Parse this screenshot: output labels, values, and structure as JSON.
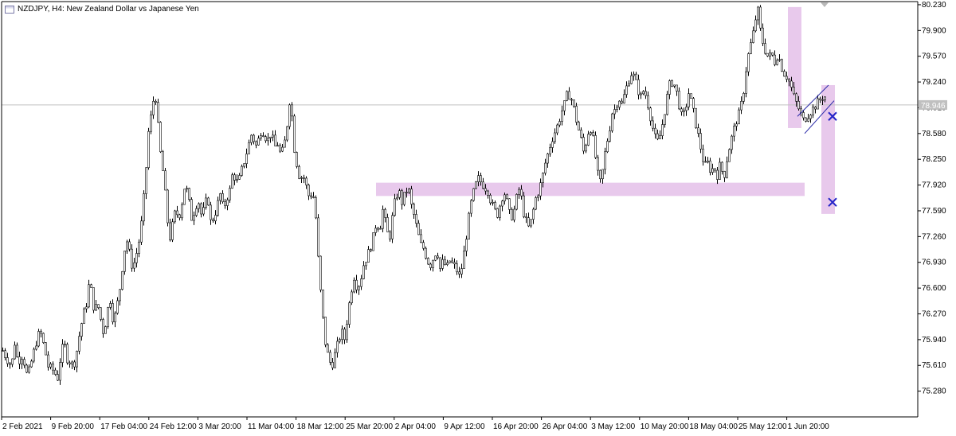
{
  "window": {
    "symbol_title": "NZDJPY, H4:  New Zealand Dollar vs Japanese Yen"
  },
  "current_price_label": "78.946",
  "colors": {
    "candle": "#000000",
    "zone": "#e8c9ec",
    "trend_lines": "#2a2aa8",
    "marker_x": "#2424c8",
    "price_line": "#c0c0c0",
    "axis": "#000000"
  },
  "chart_data": {
    "type": "bar",
    "title": "NZDJPY, H4:  New Zealand Dollar vs Japanese Yen",
    "ylim": [
      74.95,
      80.27
    ],
    "yticks": [
      "80.230",
      "79.900",
      "79.570",
      "79.240",
      "78.910",
      "78.580",
      "78.250",
      "77.920",
      "77.590",
      "77.260",
      "76.930",
      "76.600",
      "76.270",
      "75.940",
      "75.610",
      "75.280"
    ],
    "xticks": [
      "2 Feb 2021",
      "9 Feb 20:00",
      "17 Feb 04:00",
      "24 Feb 12:00",
      "3 Mar 20:00",
      "11 Mar 04:00",
      "18 Mar 12:00",
      "25 Mar 20:00",
      "2 Apr 04:00",
      "9 Apr 12:00",
      "16 Apr 20:00",
      "26 Apr 04:00",
      "3 May 12:00",
      "10 May 20:00",
      "18 May 04:00",
      "25 May 12:00",
      "1 Jun 20:00"
    ],
    "current_price": 78.946,
    "price_path": [
      [
        0,
        75.55
      ],
      [
        3,
        75.8
      ],
      [
        8,
        75.7
      ],
      [
        14,
        75.6
      ],
      [
        18,
        75.9
      ],
      [
        22,
        75.65
      ],
      [
        28,
        75.75
      ],
      [
        34,
        75.45
      ],
      [
        40,
        75.7
      ],
      [
        46,
        75.95
      ],
      [
        50,
        76.05
      ],
      [
        56,
        75.8
      ],
      [
        60,
        75.6
      ],
      [
        66,
        75.55
      ],
      [
        72,
        75.45
      ],
      [
        76,
        75.75
      ],
      [
        80,
        75.9
      ],
      [
        84,
        75.7
      ],
      [
        88,
        75.65
      ],
      [
        92,
        75.6
      ],
      [
        96,
        75.8
      ],
      [
        100,
        76.05
      ],
      [
        104,
        76.25
      ],
      [
        108,
        76.4
      ],
      [
        112,
        76.7
      ],
      [
        115,
        76.5
      ],
      [
        118,
        76.3
      ],
      [
        122,
        76.4
      ],
      [
        126,
        76.2
      ],
      [
        130,
        76.0
      ],
      [
        134,
        76.3
      ],
      [
        138,
        76.45
      ],
      [
        142,
        76.15
      ],
      [
        146,
        76.35
      ],
      [
        150,
        76.6
      ],
      [
        154,
        76.95
      ],
      [
        158,
        77.25
      ],
      [
        162,
        77.05
      ],
      [
        166,
        76.85
      ],
      [
        170,
        77.0
      ],
      [
        174,
        77.2
      ],
      [
        178,
        77.5
      ],
      [
        182,
        78.0
      ],
      [
        186,
        78.6
      ],
      [
        190,
        78.85
      ],
      [
        192,
        79.0
      ],
      [
        194,
        79.15
      ],
      [
        197,
        78.8
      ],
      [
        200,
        78.4
      ],
      [
        204,
        78.1
      ],
      [
        208,
        77.7
      ],
      [
        212,
        77.2
      ],
      [
        216,
        77.4
      ],
      [
        220,
        77.6
      ],
      [
        224,
        77.5
      ],
      [
        228,
        77.7
      ],
      [
        232,
        77.95
      ],
      [
        236,
        77.75
      ],
      [
        240,
        77.5
      ],
      [
        244,
        77.6
      ],
      [
        248,
        77.75
      ],
      [
        252,
        77.55
      ],
      [
        256,
        77.6
      ],
      [
        260,
        77.8
      ],
      [
        264,
        77.45
      ],
      [
        268,
        77.5
      ],
      [
        272,
        77.65
      ],
      [
        276,
        77.8
      ],
      [
        280,
        77.6
      ],
      [
        284,
        77.75
      ],
      [
        288,
        77.85
      ],
      [
        292,
        78.1
      ],
      [
        296,
        77.95
      ],
      [
        300,
        78.0
      ],
      [
        304,
        78.15
      ],
      [
        308,
        78.3
      ],
      [
        312,
        78.45
      ],
      [
        316,
        78.6
      ],
      [
        320,
        78.4
      ],
      [
        324,
        78.5
      ],
      [
        328,
        78.65
      ],
      [
        332,
        78.55
      ],
      [
        336,
        78.5
      ],
      [
        340,
        78.6
      ],
      [
        344,
        78.4
      ],
      [
        348,
        78.45
      ],
      [
        352,
        78.3
      ],
      [
        356,
        78.4
      ],
      [
        360,
        78.7
      ],
      [
        363,
        79.0
      ],
      [
        366,
        78.8
      ],
      [
        368,
        78.45
      ],
      [
        372,
        78.2
      ],
      [
        376,
        78.0
      ],
      [
        380,
        78.05
      ],
      [
        384,
        77.9
      ],
      [
        388,
        77.75
      ],
      [
        392,
        77.85
      ],
      [
        396,
        77.5
      ],
      [
        400,
        76.8
      ],
      [
        404,
        76.3
      ],
      [
        408,
        75.9
      ],
      [
        412,
        75.7
      ],
      [
        416,
        75.6
      ],
      [
        420,
        75.75
      ],
      [
        424,
        75.9
      ],
      [
        428,
        76.05
      ],
      [
        432,
        75.95
      ],
      [
        436,
        76.25
      ],
      [
        440,
        76.55
      ],
      [
        444,
        76.75
      ],
      [
        448,
        76.6
      ],
      [
        452,
        76.7
      ],
      [
        456,
        76.9
      ],
      [
        460,
        77.0
      ],
      [
        464,
        77.1
      ],
      [
        468,
        77.25
      ],
      [
        472,
        77.45
      ],
      [
        476,
        77.35
      ],
      [
        480,
        77.6
      ],
      [
        484,
        77.4
      ],
      [
        488,
        77.2
      ],
      [
        492,
        77.5
      ],
      [
        496,
        77.75
      ],
      [
        500,
        77.85
      ],
      [
        504,
        77.7
      ],
      [
        508,
        77.8
      ],
      [
        512,
        77.9
      ],
      [
        516,
        77.65
      ],
      [
        520,
        77.5
      ],
      [
        524,
        77.3
      ],
      [
        528,
        77.15
      ],
      [
        532,
        77.1
      ],
      [
        536,
        76.95
      ],
      [
        540,
        76.9
      ],
      [
        544,
        77.0
      ],
      [
        548,
        77.1
      ],
      [
        552,
        76.85
      ],
      [
        556,
        76.95
      ],
      [
        560,
        76.85
      ],
      [
        564,
        76.95
      ],
      [
        568,
        76.9
      ],
      [
        572,
        76.85
      ],
      [
        576,
        76.75
      ],
      [
        580,
        76.9
      ],
      [
        584,
        77.2
      ],
      [
        588,
        77.5
      ],
      [
        592,
        77.75
      ],
      [
        596,
        77.9
      ],
      [
        600,
        78.0
      ],
      [
        604,
        77.95
      ],
      [
        608,
        77.9
      ],
      [
        612,
        77.85
      ],
      [
        616,
        77.7
      ],
      [
        620,
        77.6
      ],
      [
        624,
        77.55
      ],
      [
        628,
        77.7
      ],
      [
        632,
        77.85
      ],
      [
        636,
        77.7
      ],
      [
        640,
        77.5
      ],
      [
        644,
        77.55
      ],
      [
        648,
        77.75
      ],
      [
        652,
        77.9
      ],
      [
        656,
        77.6
      ],
      [
        660,
        77.45
      ],
      [
        664,
        77.35
      ],
      [
        668,
        77.55
      ],
      [
        672,
        77.75
      ],
      [
        676,
        77.85
      ],
      [
        680,
        78.0
      ],
      [
        684,
        78.2
      ],
      [
        688,
        78.35
      ],
      [
        692,
        78.5
      ],
      [
        696,
        78.6
      ],
      [
        700,
        78.7
      ],
      [
        704,
        78.85
      ],
      [
        708,
        78.95
      ],
      [
        712,
        79.1
      ],
      [
        716,
        79.05
      ],
      [
        720,
        78.9
      ],
      [
        724,
        78.7
      ],
      [
        728,
        78.55
      ],
      [
        732,
        78.35
      ],
      [
        736,
        78.5
      ],
      [
        740,
        78.7
      ],
      [
        744,
        78.5
      ],
      [
        748,
        78.2
      ],
      [
        752,
        77.9
      ],
      [
        756,
        78.1
      ],
      [
        760,
        78.4
      ],
      [
        764,
        78.6
      ],
      [
        768,
        78.85
      ],
      [
        772,
        78.9
      ],
      [
        776,
        79.05
      ],
      [
        780,
        78.95
      ],
      [
        784,
        79.1
      ],
      [
        788,
        79.25
      ],
      [
        792,
        79.35
      ],
      [
        796,
        79.3
      ],
      [
        800,
        79.15
      ],
      [
        804,
        79.05
      ],
      [
        808,
        79.15
      ],
      [
        812,
        79.0
      ],
      [
        816,
        78.8
      ],
      [
        820,
        78.6
      ],
      [
        824,
        78.45
      ],
      [
        828,
        78.55
      ],
      [
        832,
        78.75
      ],
      [
        836,
        79.0
      ],
      [
        840,
        79.2
      ],
      [
        844,
        79.25
      ],
      [
        848,
        79.15
      ],
      [
        852,
        78.95
      ],
      [
        856,
        78.75
      ],
      [
        860,
        78.9
      ],
      [
        864,
        79.1
      ],
      [
        868,
        78.95
      ],
      [
        872,
        78.75
      ],
      [
        876,
        78.55
      ],
      [
        880,
        78.35
      ],
      [
        884,
        78.15
      ],
      [
        888,
        78.2
      ],
      [
        892,
        78.1
      ],
      [
        896,
        78.15
      ],
      [
        900,
        78.05
      ],
      [
        904,
        78.2
      ],
      [
        908,
        78.0
      ],
      [
        912,
        78.25
      ],
      [
        916,
        78.45
      ],
      [
        920,
        78.6
      ],
      [
        924,
        78.75
      ],
      [
        928,
        78.85
      ],
      [
        932,
        79.05
      ],
      [
        936,
        79.4
      ],
      [
        940,
        79.65
      ],
      [
        944,
        79.8
      ],
      [
        948,
        80.05
      ],
      [
        951,
        80.15
      ],
      [
        954,
        79.9
      ],
      [
        957,
        79.75
      ],
      [
        960,
        79.65
      ],
      [
        964,
        79.55
      ],
      [
        968,
        79.6
      ],
      [
        972,
        79.5
      ],
      [
        976,
        79.6
      ],
      [
        980,
        79.45
      ],
      [
        984,
        79.35
      ],
      [
        988,
        79.3
      ],
      [
        992,
        79.2
      ],
      [
        996,
        79.05
      ],
      [
        1000,
        78.95
      ],
      [
        1004,
        78.85
      ],
      [
        1008,
        78.75
      ],
      [
        1012,
        78.8
      ],
      [
        1016,
        78.85
      ],
      [
        1020,
        78.9
      ],
      [
        1024,
        78.95
      ],
      [
        1028,
        79.0
      ],
      [
        1032,
        79.05
      ],
      [
        1035,
        79.05
      ]
    ],
    "zones": [
      {
        "x0": 989,
        "x1": 1006,
        "high": 80.2,
        "low": 78.65
      },
      {
        "x0": 472,
        "x1": 1010,
        "high": 77.95,
        "low": 77.78
      },
      {
        "x0": 1031,
        "x1": 1048,
        "high": 79.2,
        "low": 77.55
      }
    ],
    "trend_lines": [
      {
        "xa": 1001,
        "ya": 78.8,
        "xb": 1040,
        "yb": 79.2
      },
      {
        "xa": 1010,
        "ya": 78.58,
        "xb": 1047,
        "yb": 79.0
      }
    ],
    "markers": [
      {
        "x": 1045,
        "price": 78.8
      },
      {
        "x": 1045,
        "price": 77.7
      }
    ],
    "alert_triangle_x": 1035
  }
}
